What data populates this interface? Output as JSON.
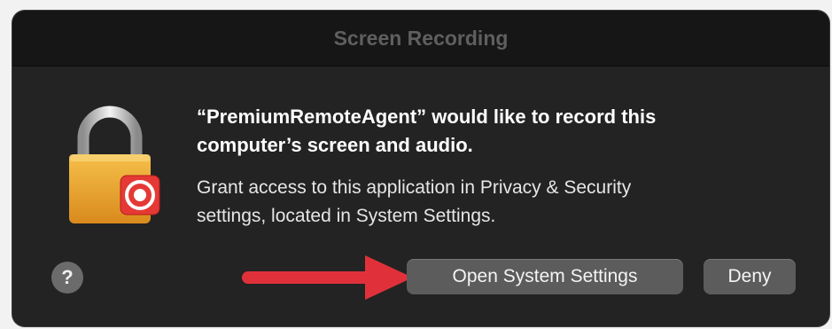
{
  "dialog": {
    "title": "Screen Recording",
    "heading_line1": "“PremiumRemoteAgent” would like to record this",
    "heading_line2": "computer’s screen and audio.",
    "body_line1": "Grant access to this application in Privacy & Security",
    "body_line2": "settings, located in System Settings.",
    "help_label": "?",
    "icon": "lock-with-record-badge-icon"
  },
  "buttons": {
    "open_settings_label": "Open System Settings",
    "deny_label": "Deny"
  },
  "annotation": {
    "arrow_icon": "red-arrow-icon",
    "arrow_color": "#e0313b"
  },
  "colors": {
    "dialog_bg": "#232323",
    "button_bg": "#5c5c5c",
    "record_badge": "#e53935"
  }
}
